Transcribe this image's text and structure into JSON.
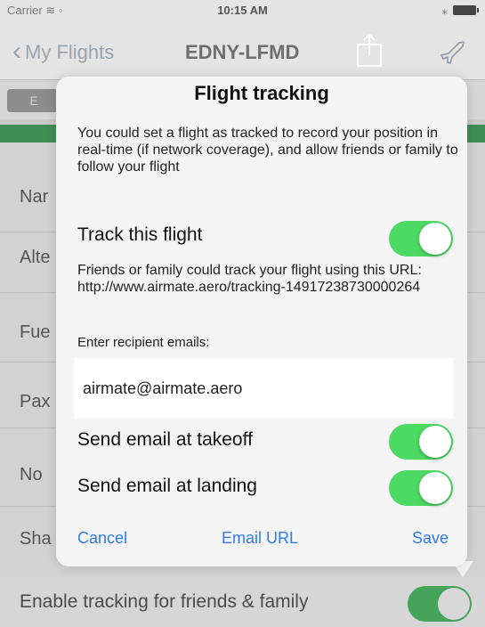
{
  "status_bar": {
    "carrier": "Carrier ≋ ◦",
    "time": "10:15 AM",
    "battery": "⁎"
  },
  "nav": {
    "back_label": "My Flights",
    "title": "EDNY-LFMD"
  },
  "background": {
    "segment_first": "E",
    "rows": [
      "Nar",
      "Alte",
      "Fue",
      "Pax",
      "No",
      "Sha"
    ],
    "bottom_label": "Enable tracking for friends & family"
  },
  "dialog": {
    "title": "Flight tracking",
    "description": "You could set a flight as tracked to record your position in real-time (if network coverage), and allow friends or family to follow your flight",
    "track_label": "Track this flight",
    "url_text": "Friends or family could track your flight using this URL: http://www.airmate.aero/tracking-14917238730000264",
    "recipient_label": "Enter recipient emails:",
    "recipient_value": "airmate@airmate.aero",
    "takeoff_label": "Send email at takeoff",
    "landing_label": "Send email at landing",
    "cancel_label": "Cancel",
    "email_url_label": "Email URL",
    "save_label": "Save"
  },
  "colors": {
    "accent": "#2f7cf6",
    "toggle_on": "#4cd964",
    "status_green": "#3f8d55"
  },
  "toggles": {
    "track": true,
    "takeoff": true,
    "landing": true,
    "tracking_enabled": true
  }
}
